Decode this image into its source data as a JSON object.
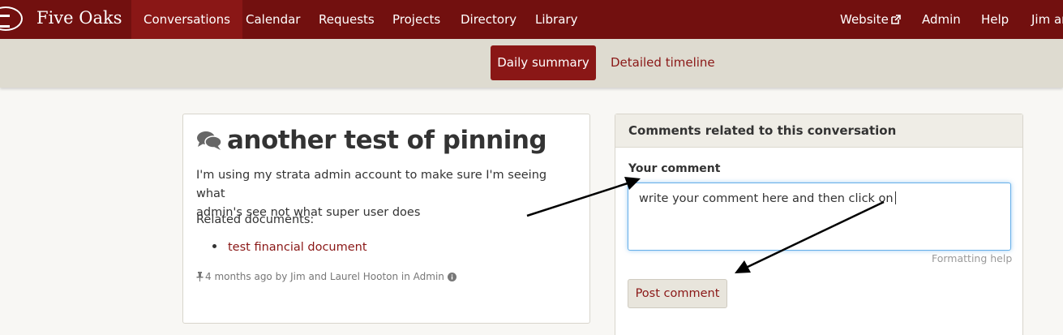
{
  "brand": {
    "name": "Five Oaks"
  },
  "nav": {
    "items": [
      {
        "label": "Conversations"
      },
      {
        "label": "Calendar"
      },
      {
        "label": "Requests"
      },
      {
        "label": "Projects"
      },
      {
        "label": "Directory"
      },
      {
        "label": "Library"
      }
    ],
    "right": [
      {
        "label": "Website",
        "icon": "external-link-icon"
      },
      {
        "label": "Admin"
      },
      {
        "label": "Help"
      },
      {
        "label": "Jim ar"
      }
    ],
    "active_index": 0
  },
  "subnav": {
    "tabs": [
      {
        "label": "Daily summary",
        "active": true
      },
      {
        "label": "Detailed timeline",
        "active": false
      }
    ]
  },
  "conversation": {
    "icon": "comments-icon",
    "title": "another test of pinning",
    "body_line1": "I'm using my strata admin account to make sure I'm seeing what",
    "body_line2": "admin's see not what super user does",
    "related_label": "Related documents:",
    "documents": [
      "test financial document"
    ],
    "meta": "4 months ago by Jim and Laurel Hooton in Admin"
  },
  "comments": {
    "header": "Comments related to this conversation",
    "your_comment_label": "Your comment",
    "input_value": "write your comment here and then click on",
    "formatting_help": "Formatting help",
    "post_button": "Post comment"
  },
  "colors": {
    "navbar": "#72100f",
    "accent": "#8a1716",
    "subnav": "#dedbd0",
    "focus": "#66afe9"
  }
}
